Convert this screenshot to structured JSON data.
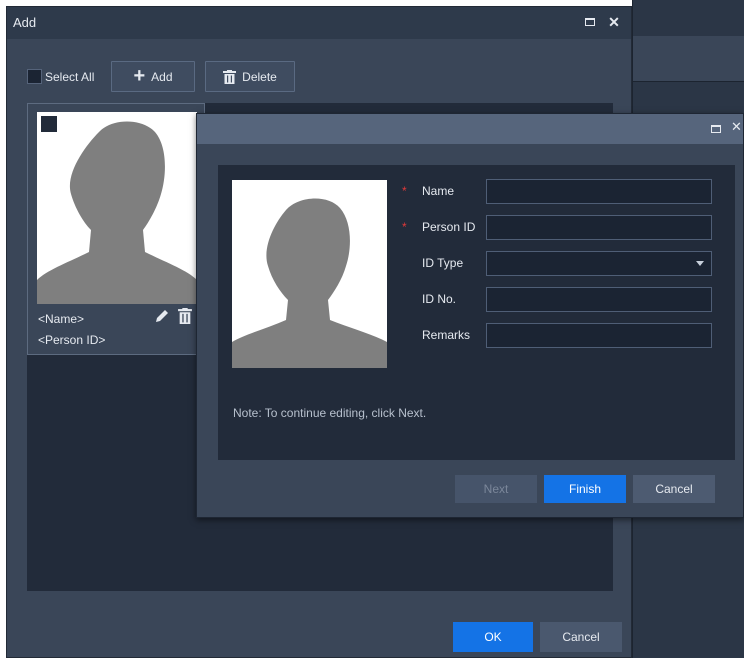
{
  "colors": {
    "accent": "#1473e6",
    "required": "#e23a3a",
    "panel": "#222b3a",
    "dialog": "#3a4658"
  },
  "add_dialog": {
    "title": "Add",
    "toolbar": {
      "select_all_label": "Select All",
      "add_label": "Add",
      "delete_label": "Delete"
    },
    "card": {
      "name_placeholder": "<Name>",
      "id_placeholder": "<Person ID>",
      "photo_icon": "person-silhouette-icon"
    },
    "footer": {
      "ok_label": "OK",
      "cancel_label": "Cancel"
    }
  },
  "person_dialog": {
    "fields": [
      {
        "label": "Name",
        "required": "*",
        "value": ""
      },
      {
        "label": "Person ID",
        "required": "*",
        "value": ""
      },
      {
        "label": "ID Type",
        "required": "",
        "value": ""
      },
      {
        "label": "ID No.",
        "required": "",
        "value": ""
      },
      {
        "label": "Remarks",
        "required": "",
        "value": ""
      }
    ],
    "note": "Note: To continue editing, click Next.",
    "buttons": {
      "next_label": "Next",
      "finish_label": "Finish",
      "cancel_label": "Cancel"
    }
  }
}
